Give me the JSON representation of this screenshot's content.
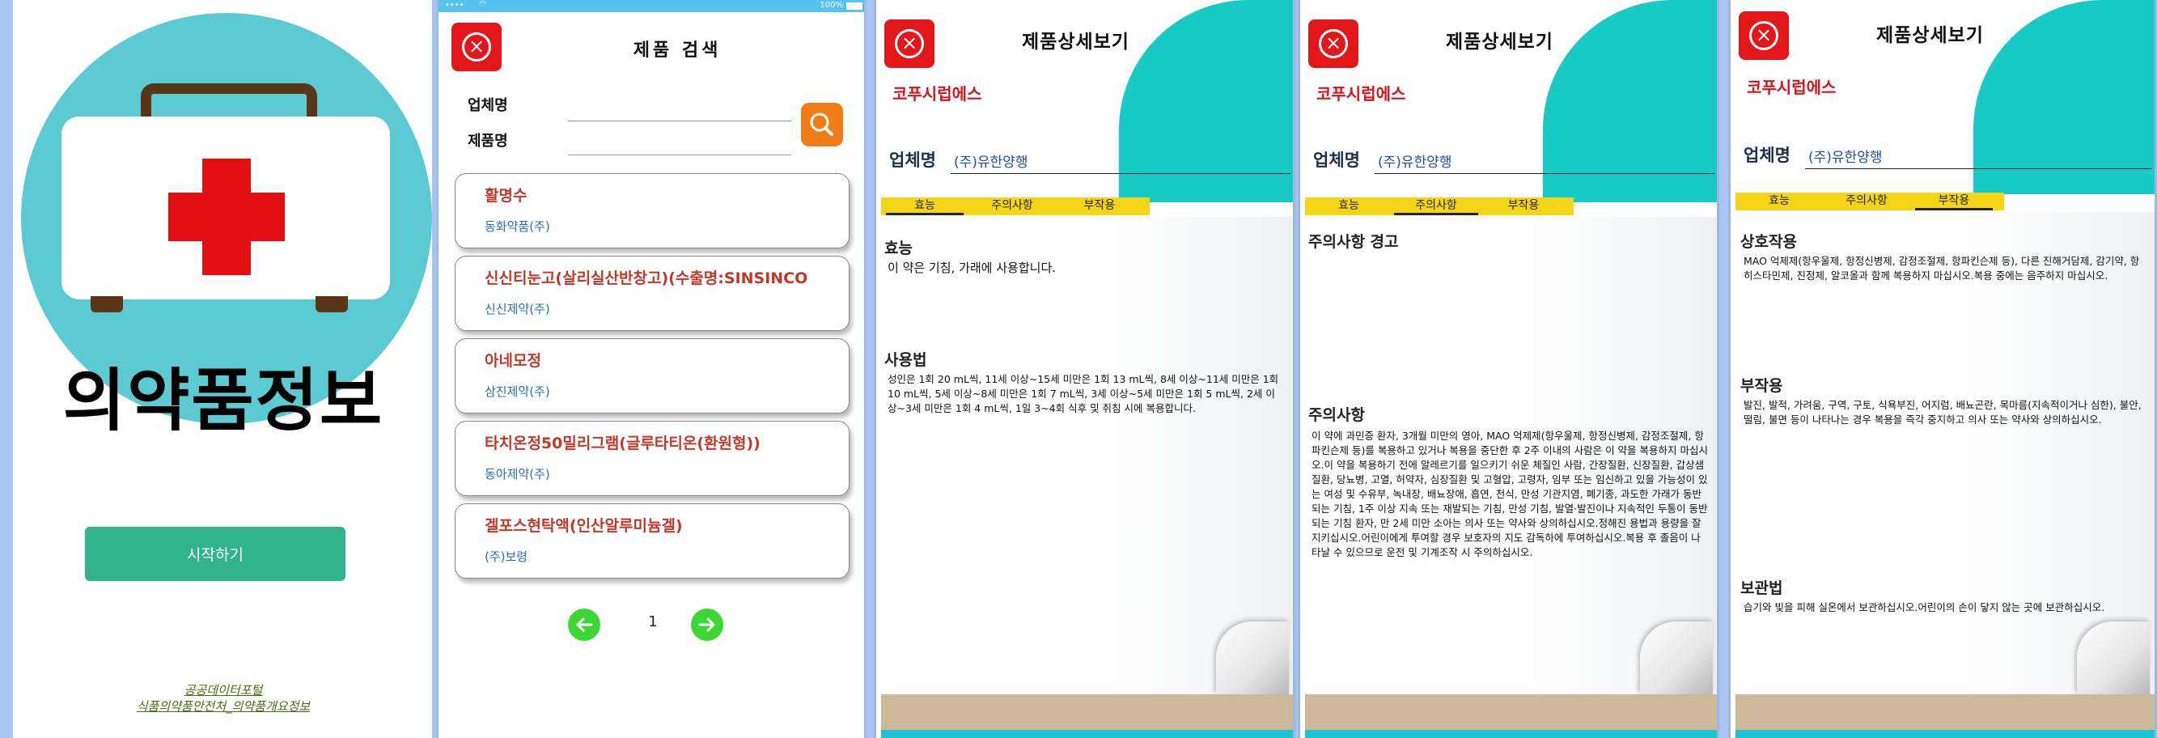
{
  "splash": {
    "app_title": "의약품정보",
    "start_button": "시작하기",
    "credits": [
      "공공데이터포털",
      "식품의약품안전처_의약품개요정보"
    ]
  },
  "search": {
    "status_right": "100%",
    "title": "제품 검색",
    "company_label": "업체명",
    "product_label": "제품명",
    "company_value": "",
    "product_value": "",
    "results": [
      {
        "name": "활명수",
        "firm": "동화약품(주)"
      },
      {
        "name": "신신티눈고(살리실산반창고)(수출명:SINSINCO",
        "firm": "신신제약(주)"
      },
      {
        "name": "아네모정",
        "firm": "삼진제약(주)"
      },
      {
        "name": "타치온정50밀리그램(글루타티온(환원형))",
        "firm": "동아제약(주)"
      },
      {
        "name": "겔포스현탁액(인산알루미늄겔)",
        "firm": "(주)보령"
      }
    ],
    "page": "1"
  },
  "details": [
    {
      "title": "제품상세보기",
      "product": "코푸시럽에스",
      "company_label": "업체명",
      "company": "(주)유한양행",
      "tabs": [
        "효능",
        "주의사항",
        "부작용"
      ],
      "active_tab": 0,
      "sections": [
        {
          "heading": "효능",
          "body": "이 약은 기침, 가래에 사용합니다."
        },
        {
          "heading": "사용법",
          "body": "성인은 1회 20 mL씩, 11세 이상~15세 미만은 1회 13 mL씩, 8세 이상~11세 미만은 1회 10 mL씩, 5세 이상~8세 미만은 1회 7 mL씩, 3세 이상~5세 미만은 1회 5 mL씩, 2세 이상~3세 미만은 1회 4 mL씩, 1일 3~4회 식후 및 취침 시에 복용합니다."
        }
      ]
    },
    {
      "title": "제품상세보기",
      "product": "코푸시럽에스",
      "company_label": "업체명",
      "company": "(주)유한양행",
      "tabs": [
        "효능",
        "주의사항",
        "부작용"
      ],
      "active_tab": 1,
      "sections": [
        {
          "heading": "주의사항 경고",
          "body": ""
        },
        {
          "heading": "주의사항",
          "body": "이 약에 과민증 환자, 3개월 미만의 영아, MAO 억제제(항우울제, 항정신병제, 감정조절제, 항파킨슨제 등)를 복용하고 있거나 복용을 중단한 후 2주 이내의 사람은 이 약을 복용하지 마십시오.이 약을 복용하기 전에 알레르기를 일으키기 쉬운 체질인 사람, 간장질환, 신장질환, 갑상샘질환, 당뇨병, 고열, 허약자, 심장질환 및 고혈압, 고령자, 임부 또는 임신하고 있을 가능성이 있는 여성 및 수유부, 녹내장, 배뇨장애, 흡연, 천식, 만성 기관지염, 폐기종, 과도한 가래가 동반되는 기침, 1주 이상 지속 또는 재발되는 기침, 만성 기침, 발열·발진이나 지속적인 두통이 동반되는 기침 환자, 만 2세 미만 소아는 의사 또는 약사와 상의하십시오.정해진 용법과 용량을 잘 지키십시오.어린이에게 투여할 경우 보호자의 지도 감독하에 투여하십시오.복용 후 졸음이 나타날 수 있으므로 운전 및 기계조작 시 주의하십시오."
        }
      ]
    },
    {
      "title": "제품상세보기",
      "product": "코푸시럽에스",
      "company_label": "업체명",
      "company": "(주)유한양행",
      "tabs": [
        "효능",
        "주의사항",
        "부작용"
      ],
      "active_tab": 2,
      "sections": [
        {
          "heading": "상호작용",
          "body": "MAO 억제제(항우울제, 항정신병제, 감정조절제, 항파킨슨제 등), 다른 진해거담제, 감기약, 항히스타민제, 진정제, 알코올과 함께 복용하지 마십시오.복용 중에는 음주하지 마십시오."
        },
        {
          "heading": "부작용",
          "body": "발진, 발적, 가려움, 구역, 구토, 식욕부진, 어지럼, 배뇨곤란, 목마름(지속적이거나 심한), 불안, 떨림, 불면 등이 나타나는 경우 복용을 즉각 중지하고 의사 또는 약사와 상의하십시오."
        },
        {
          "heading": "보관법",
          "body": "습기와 빛을 피해 실온에서 보관하십시오.어린이의 손이 닿지 않는 곳에 보관하십시오."
        }
      ]
    }
  ]
}
